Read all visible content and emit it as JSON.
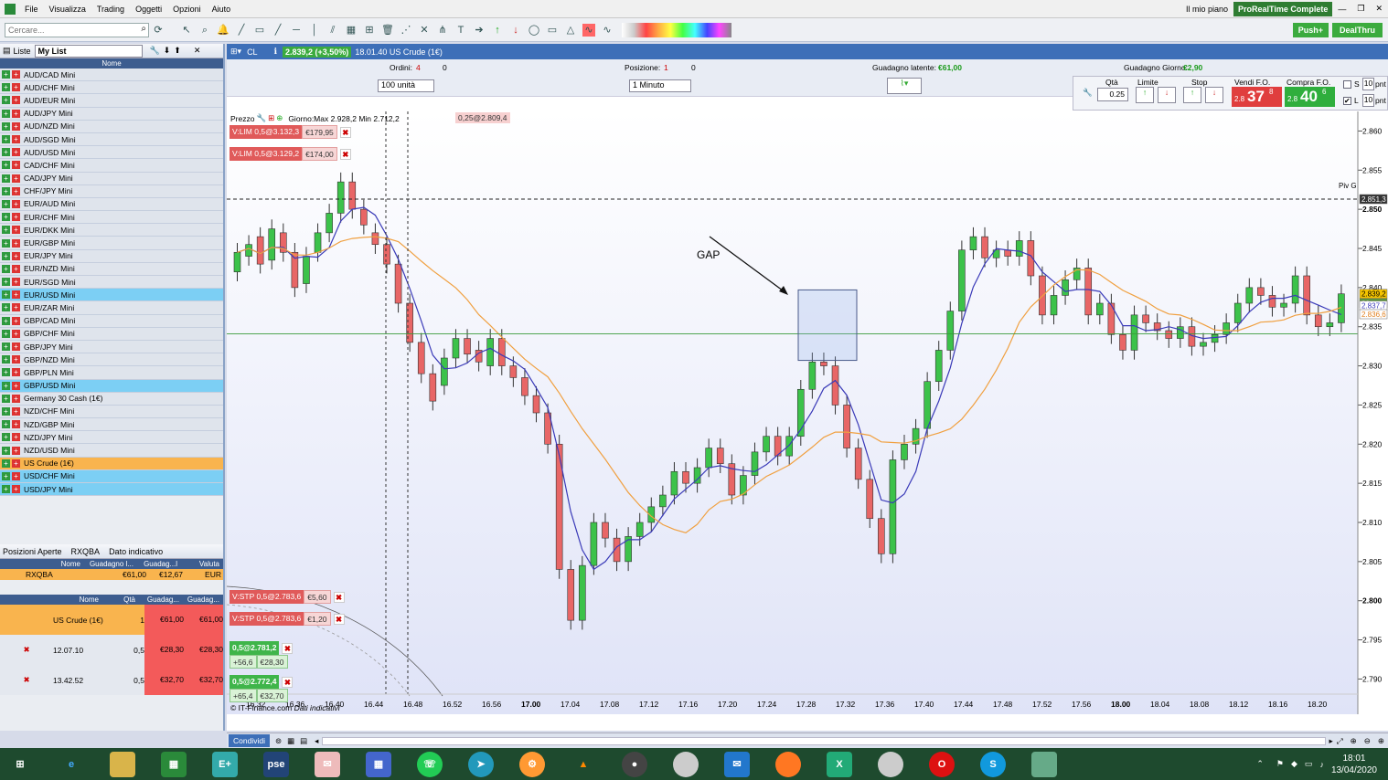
{
  "menu": [
    "File",
    "Visualizza",
    "Trading",
    "Oggetti",
    "Opzioni",
    "Aiuto"
  ],
  "topright": {
    "plan": "Il mio piano",
    "brand": "ProRealTime Complete"
  },
  "search": {
    "placeholder": "Cercare..."
  },
  "buttons": {
    "push": "Push+",
    "dealthru": "DealThru"
  },
  "watchlist": {
    "tab": "Liste",
    "list_name": "My List",
    "col_name": "Nome",
    "items": [
      {
        "name": "AUD/CAD Mini",
        "hl": ""
      },
      {
        "name": "AUD/CHF Mini",
        "hl": ""
      },
      {
        "name": "AUD/EUR Mini",
        "hl": ""
      },
      {
        "name": "AUD/JPY Mini",
        "hl": ""
      },
      {
        "name": "AUD/NZD Mini",
        "hl": ""
      },
      {
        "name": "AUD/SGD Mini",
        "hl": ""
      },
      {
        "name": "AUD/USD Mini",
        "hl": ""
      },
      {
        "name": "CAD/CHF Mini",
        "hl": ""
      },
      {
        "name": "CAD/JPY Mini",
        "hl": ""
      },
      {
        "name": "CHF/JPY Mini",
        "hl": ""
      },
      {
        "name": "EUR/AUD Mini",
        "hl": ""
      },
      {
        "name": "EUR/CHF Mini",
        "hl": ""
      },
      {
        "name": "EUR/DKK Mini",
        "hl": ""
      },
      {
        "name": "EUR/GBP Mini",
        "hl": ""
      },
      {
        "name": "EUR/JPY Mini",
        "hl": ""
      },
      {
        "name": "EUR/NZD Mini",
        "hl": ""
      },
      {
        "name": "EUR/SGD Mini",
        "hl": ""
      },
      {
        "name": "EUR/USD Mini",
        "hl": "blue"
      },
      {
        "name": "EUR/ZAR Mini",
        "hl": ""
      },
      {
        "name": "GBP/CAD Mini",
        "hl": ""
      },
      {
        "name": "GBP/CHF Mini",
        "hl": ""
      },
      {
        "name": "GBP/JPY Mini",
        "hl": ""
      },
      {
        "name": "GBP/NZD Mini",
        "hl": ""
      },
      {
        "name": "GBP/PLN Mini",
        "hl": ""
      },
      {
        "name": "GBP/USD Mini",
        "hl": "blue"
      },
      {
        "name": "Germany 30 Cash (1€)",
        "hl": ""
      },
      {
        "name": "NZD/CHF Mini",
        "hl": ""
      },
      {
        "name": "NZD/GBP Mini",
        "hl": ""
      },
      {
        "name": "NZD/JPY Mini",
        "hl": ""
      },
      {
        "name": "NZD/USD Mini",
        "hl": ""
      },
      {
        "name": "US Crude (1€)",
        "hl": "orange"
      },
      {
        "name": "USD/CHF Mini",
        "hl": "blue"
      },
      {
        "name": "USD/JPY Mini",
        "hl": "blue"
      }
    ]
  },
  "positions": {
    "tabs": [
      "Posizioni Aperte",
      "RXQBA",
      "Dato indicativo"
    ],
    "head1": [
      "Nome",
      "Guadagno l...",
      "Guadag...l",
      "Valuta"
    ],
    "acct": {
      "name": "RXQBA",
      "g1": "€61,00",
      "g2": "€12,67",
      "cur": "EUR"
    },
    "head2": [
      "Nome",
      "Qtà",
      "Guadag...",
      "Guadag..."
    ],
    "main": {
      "name": "US Crude (1€)",
      "qty": "1",
      "g1": "€61,00",
      "g2": "€61,00"
    },
    "rows": [
      {
        "time": "12.07.10",
        "qty": "0,5",
        "g1": "€28,30",
        "g2": "€28,30"
      },
      {
        "time": "13.42.52",
        "qty": "0,5",
        "g1": "€32,70",
        "g2": "€32,70"
      }
    ]
  },
  "chart": {
    "symbol": "CL",
    "price_badge": "2.839,2 (+3,50%)",
    "title": "18.01.40 US Crude (1€)",
    "ordini": "Ordini:",
    "ordini_val": "4",
    "ordini_val2": "0",
    "posizione": "Posizione:",
    "posizione_val": "1",
    "posizione_val2": "0",
    "guadagno_latente": "Guadagno latente:",
    "guadagno_latente_val": "€61,00",
    "guadagno_giorno": "Guadagno Giorno:",
    "guadagno_giorno_val": "€2,90",
    "units": "100 unità",
    "timeframe": "1 Minuto",
    "qta_label": "Qtà",
    "qta_val": "0.25",
    "limite": "Limite",
    "stop": "Stop",
    "vendi": "Vendi F.O.",
    "vendi_small": "2.8",
    "vendi_big": "37",
    "vendi_sup": "8",
    "compra": "Compra F.O.",
    "compra_small": "2.8",
    "compra_big": "40",
    "compra_sup": "6",
    "s_label": "S",
    "l_label": "L",
    "s_val": "10",
    "l_val": "10",
    "pnt": "pnt",
    "prezzo": "Prezzo",
    "giorno": "Giorno:Max 2.928,2 Min 2.712,2",
    "cursor_badge": "0,25@2.809,4",
    "gap_label": "GAP",
    "piv_label": "Piv G",
    "footer": "© IT-Finance.com",
    "footer2": "Dati indicativi",
    "orders": [
      {
        "type": "red",
        "label": "V:LIM 0,5@3.132,3",
        "val": "€179,95"
      },
      {
        "type": "red",
        "label": "V:LIM 0,5@3.129,2",
        "val": "€174,00"
      },
      {
        "type": "red",
        "label": "V:STP 0,5@2.783,6",
        "val": "€5,60"
      },
      {
        "type": "red",
        "label": "V:STP 0,5@2.783,6",
        "val": "€1,20"
      },
      {
        "type": "green",
        "label": "0,5@2.781,2",
        "val1": "+56,6",
        "val2": "€28,30"
      },
      {
        "type": "green",
        "label": "0,5@2.772,4",
        "val1": "+65,4",
        "val2": "€32,70"
      }
    ],
    "price_labels": [
      "2.860",
      "2.855",
      "2.850",
      "2.845",
      "2.840",
      "2.835",
      "2.830",
      "2.825",
      "2.820",
      "2.815",
      "2.810",
      "2.805",
      "2.800",
      "2.795",
      "2.790"
    ],
    "right_badges": [
      "2.851,3",
      "2.839,2",
      "20s",
      "2.837,7",
      "2.836,6"
    ],
    "time_labels": [
      "16.32",
      "16.36",
      "16.40",
      "16.44",
      "16.48",
      "16.52",
      "16.56",
      "17.00",
      "17.04",
      "17.08",
      "17.12",
      "17.16",
      "17.20",
      "17.24",
      "17.28",
      "17.32",
      "17.36",
      "17.40",
      "17.44",
      "17.48",
      "17.52",
      "17.56",
      "18.00",
      "18.04",
      "18.08",
      "18.12",
      "18.16",
      "18.20"
    ],
    "share": "Condividi",
    "colors": {
      "up": "#3cc24a",
      "down": "#e86666",
      "ma_fast": "#3a3ab8",
      "ma_slow": "#f0a040",
      "hline": "#3a9a3a"
    }
  },
  "taskbar": {
    "time": "18:01",
    "date": "13/04/2020"
  }
}
